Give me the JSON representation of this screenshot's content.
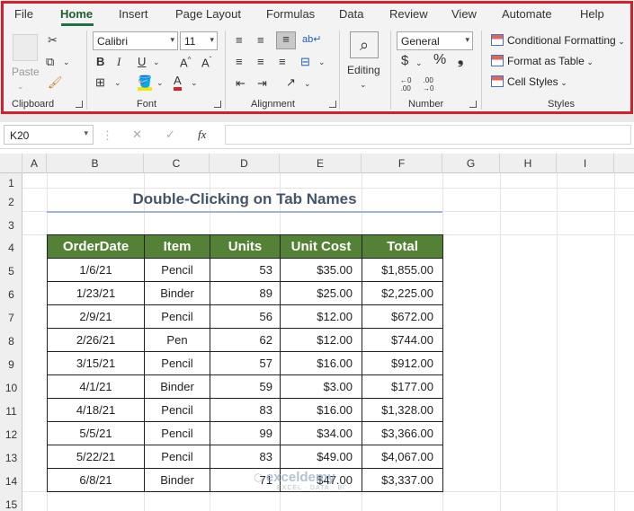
{
  "menu": {
    "tabs": [
      "File",
      "Home",
      "Insert",
      "Page Layout",
      "Formulas",
      "Data",
      "Review",
      "View",
      "Automate",
      "Help"
    ]
  },
  "ribbon": {
    "clipboard": {
      "label": "Clipboard",
      "paste": "Paste"
    },
    "font": {
      "label": "Font",
      "name": "Calibri",
      "size": "11"
    },
    "alignment": {
      "label": "Alignment"
    },
    "editing": {
      "label": "Editing"
    },
    "number": {
      "label": "Number",
      "format": "General"
    },
    "styles": {
      "label": "Styles",
      "conditional": "Conditional Formatting",
      "format_table": "Format as Table",
      "cell_styles": "Cell Styles"
    }
  },
  "formula_bar": {
    "cell_ref": "K20",
    "fx": "fx"
  },
  "columns": [
    "A",
    "B",
    "C",
    "D",
    "E",
    "F",
    "G",
    "H",
    "I"
  ],
  "rows": [
    "1",
    "2",
    "3",
    "4",
    "5",
    "6",
    "7",
    "8",
    "9",
    "10",
    "11",
    "12",
    "13",
    "14",
    "15"
  ],
  "sheet": {
    "title": "Double-Clicking on Tab Names",
    "headers": [
      "OrderDate",
      "Item",
      "Units",
      "Unit Cost",
      "Total"
    ],
    "rows": [
      [
        "1/6/21",
        "Pencil",
        "53",
        "$35.00",
        "$1,855.00"
      ],
      [
        "1/23/21",
        "Binder",
        "89",
        "$25.00",
        "$2,225.00"
      ],
      [
        "2/9/21",
        "Pencil",
        "56",
        "$12.00",
        "$672.00"
      ],
      [
        "2/26/21",
        "Pen",
        "62",
        "$12.00",
        "$744.00"
      ],
      [
        "3/15/21",
        "Pencil",
        "57",
        "$16.00",
        "$912.00"
      ],
      [
        "4/1/21",
        "Binder",
        "59",
        "$3.00",
        "$177.00"
      ],
      [
        "4/18/21",
        "Pencil",
        "83",
        "$16.00",
        "$1,328.00"
      ],
      [
        "5/5/21",
        "Pencil",
        "99",
        "$34.00",
        "$3,366.00"
      ],
      [
        "5/22/21",
        "Pencil",
        "83",
        "$49.00",
        "$4,067.00"
      ],
      [
        "6/8/21",
        "Binder",
        "71",
        "$47.00",
        "$3,337.00"
      ]
    ]
  },
  "watermark": {
    "name": "exceldemy",
    "tagline": "EXCEL · DATA · BI"
  },
  "colors": {
    "header_fill": "#538135",
    "title": "#44546a",
    "highlight": "#d4202a"
  }
}
